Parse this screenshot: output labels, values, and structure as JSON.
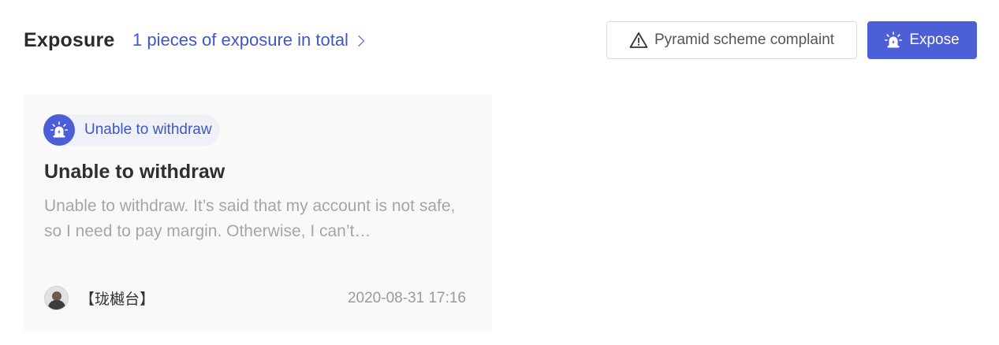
{
  "header": {
    "title": "Exposure",
    "count_text": "1 pieces of exposure in total",
    "complaint_label": "Pyramid scheme complaint",
    "expose_label": "Expose"
  },
  "card": {
    "tag_label": "Unable to withdraw",
    "title": "Unable to withdraw",
    "description": "Unable to withdraw. It’s said that my account is not safe, so I need to pay margin. Otherwise, I can’t…",
    "author": "【珑樾台】",
    "date": "2020-08-31 17:16"
  },
  "colors": {
    "accent": "#4d5fd6",
    "link": "#3f57c8"
  },
  "icons": {
    "complaint": "warning-triangle-icon",
    "expose": "alarm-siren-icon",
    "tag": "alarm-siren-icon",
    "count_link": "chevron-right-icon"
  }
}
